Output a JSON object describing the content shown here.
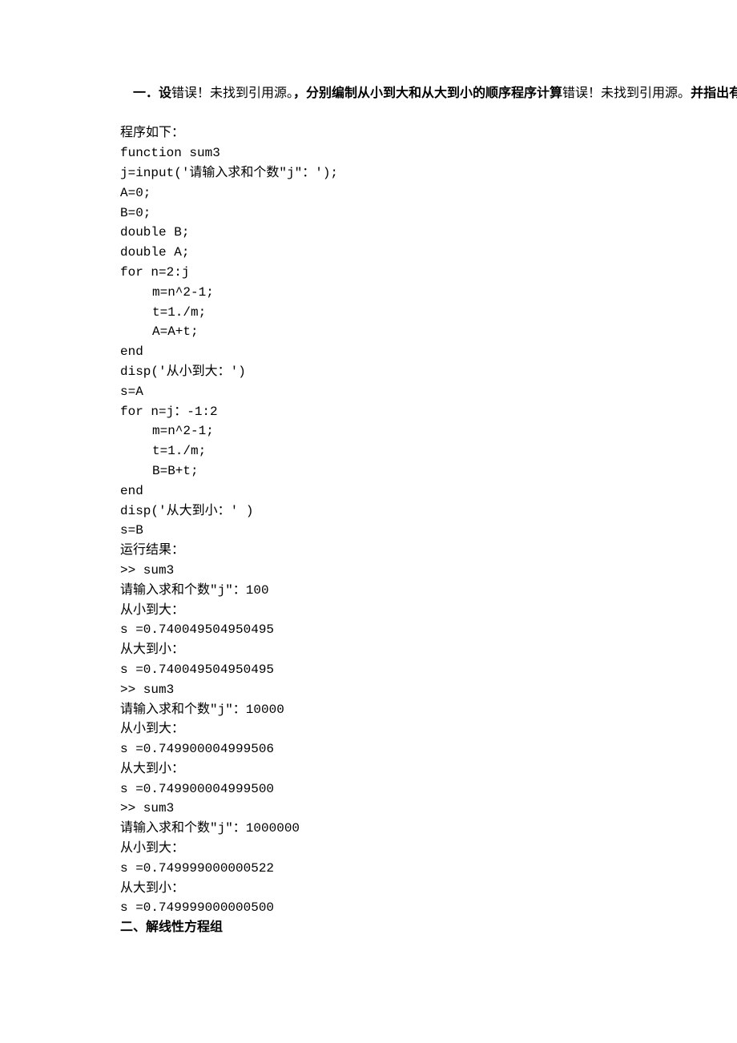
{
  "heading1": {
    "prefix": "一．设",
    "error1": "错误！未找到引用源。",
    "mid": "，分别编制从小到大和从大到小的顺序程序计算",
    "error2": "错误！未找到引用源。",
    "suffix": "并指出有效位数。"
  },
  "program_label": "程序如下：",
  "code": [
    "function sum3",
    "j=input('请输入求和个数\"j\"：');",
    "A=0;",
    "B=0;",
    "double B;",
    "double A;",
    "for n=2:j"
  ],
  "code_indent1": [
    "m=n^2-1;",
    "t=1./m;",
    "A=A+t;"
  ],
  "code_mid1": [
    "end",
    "disp('从小到大：')",
    "s=A",
    "for n=j：-1:2"
  ],
  "code_indent2": [
    "m=n^2-1;",
    "t=1./m;",
    "B=B+t;"
  ],
  "code_mid2": [
    "end",
    "disp('从大到小：' )",
    "s=B"
  ],
  "run_label": "运行结果：",
  "output": [
    ">> sum3",
    "请输入求和个数\"j\"：100",
    "从小到大：",
    "s =0.740049504950495",
    "从大到小：",
    "s =0.740049504950495",
    ">> sum3",
    "请输入求和个数\"j\"：10000",
    "从小到大：",
    "s =0.749900004999506",
    "从大到小：",
    "s =0.749900004999500",
    ">> sum3",
    "请输入求和个数\"j\"：1000000",
    "从小到大：",
    "s =0.749999000000522",
    "从大到小：",
    "s =0.749999000000500"
  ],
  "heading2": "二、解线性方程组"
}
